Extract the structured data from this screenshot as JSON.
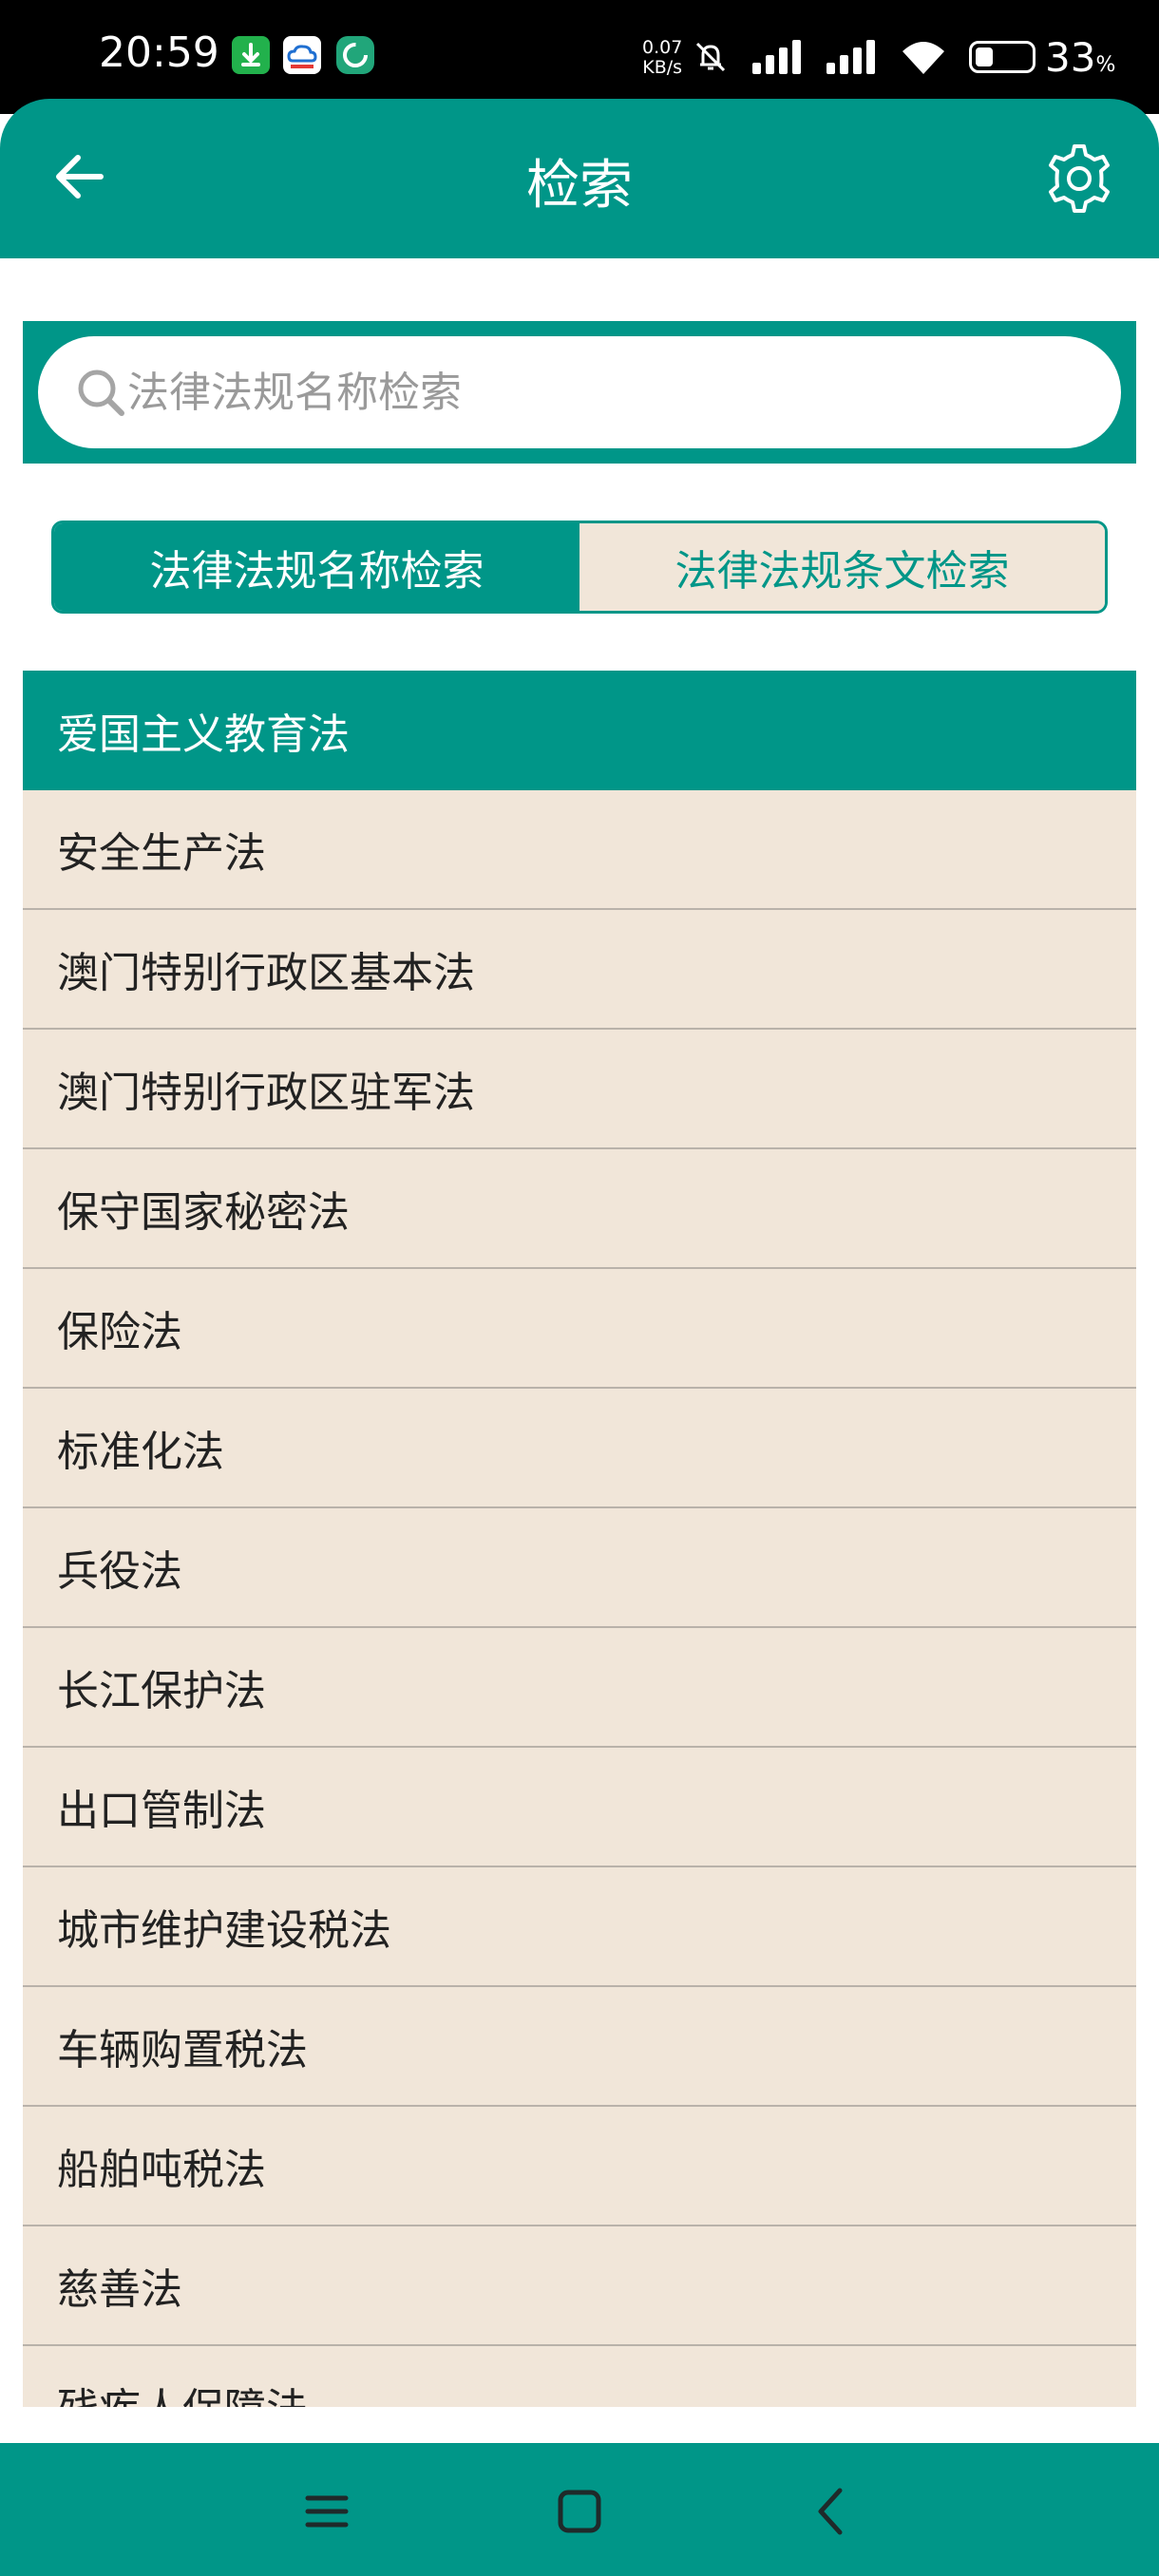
{
  "status_bar": {
    "time": "20:59",
    "net_speed_value": "0.07",
    "net_speed_unit": "KB/s",
    "battery_value": "33",
    "battery_unit": "%",
    "battery_level": 0.33,
    "icons": [
      "download-app-icon",
      "cloud-app-icon",
      "refresh-app-icon",
      "mute-icon",
      "signal-icon",
      "signal-icon",
      "wifi-icon",
      "battery-icon"
    ]
  },
  "header": {
    "title": "检索",
    "back_icon": "arrow-left-icon",
    "settings_icon": "gear-icon"
  },
  "search": {
    "placeholder": "法律法规名称检索",
    "value": ""
  },
  "tabs": [
    {
      "label": "法律法规名称检索",
      "active": true
    },
    {
      "label": "法律法规条文检索",
      "active": false
    }
  ],
  "list": {
    "items": [
      "爱国主义教育法",
      "安全生产法",
      "澳门特别行政区基本法",
      "澳门特别行政区驻军法",
      "保守国家秘密法",
      "保险法",
      "标准化法",
      "兵役法",
      "长江保护法",
      "出口管制法",
      "城市维护建设税法",
      "车辆购置税法",
      "船舶吨税法",
      "慈善法",
      "残疾人保障法"
    ]
  },
  "nav_bar": {
    "icons": [
      "menu-icon",
      "home-icon",
      "back-icon"
    ]
  },
  "colors": {
    "primary": "#009688",
    "list_background": "#f1e6d9",
    "divider": "#b9b2aa"
  }
}
